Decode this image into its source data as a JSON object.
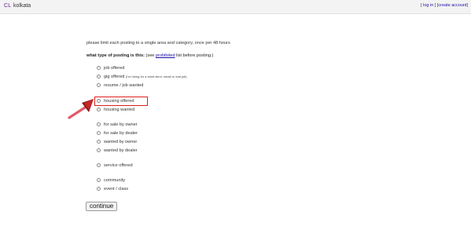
{
  "header": {
    "logo": "CL",
    "city": "kolkata",
    "account_links": {
      "open_bracket": "[",
      "login": "log in",
      "separator": "]",
      "open_bracket2": "[",
      "create": "create account",
      "close_bracket": "]"
    }
  },
  "intro_text": "please limit each posting to a single area and category, once per 48 hours",
  "question": {
    "label": "what type of posting is this:",
    "see_pre": "(see",
    "prohibited_link": "prohibited",
    "see_post": "list before posting.)"
  },
  "options": [
    {
      "label": "job offered"
    },
    {
      "label": "gig offered",
      "note": "(I'm hiring for a short-term, small or odd job)"
    },
    {
      "label": "resume / job wanted"
    },
    {
      "label": "housing offered"
    },
    {
      "label": "housing wanted"
    },
    {
      "label": "for sale by owner"
    },
    {
      "label": "for sale by dealer"
    },
    {
      "label": "wanted by owner"
    },
    {
      "label": "wanted by dealer"
    },
    {
      "label": "service offered"
    },
    {
      "label": "community"
    },
    {
      "label": "event / class"
    }
  ],
  "continue_label": "continue",
  "colors": {
    "highlight": "#e01e1e",
    "arrow": "#e05a6a",
    "link": "#1a0dab"
  }
}
